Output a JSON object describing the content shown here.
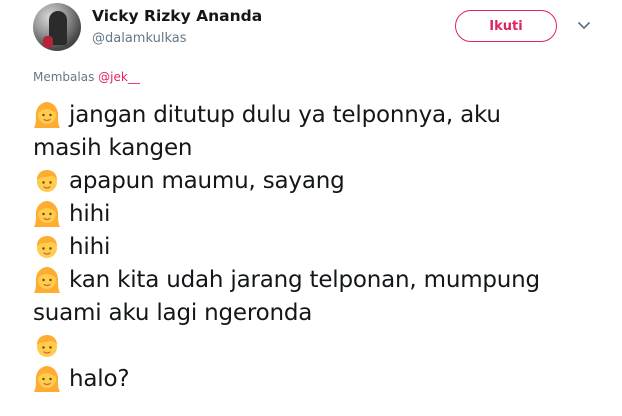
{
  "tweet": {
    "author": {
      "display_name": "Vicky Rizky Ananda",
      "handle": "@dalamkulkas"
    },
    "follow_button_label": "Ikuti",
    "reply_context": {
      "prefix": "Membalas ",
      "mention": "@jek__"
    },
    "lines": [
      {
        "emoji": "woman-emoji",
        "text": "jangan ditutup dulu ya telponnya, aku"
      },
      {
        "emoji": "",
        "text": "masih kangen"
      },
      {
        "emoji": "man-emoji",
        "text": "apapun maumu, sayang"
      },
      {
        "emoji": "woman-emoji",
        "text": "hihi"
      },
      {
        "emoji": "man-emoji",
        "text": "hihi"
      },
      {
        "emoji": "woman-emoji",
        "text": "kan kita udah jarang telponan, mumpung"
      },
      {
        "emoji": "",
        "text": "suami aku lagi ngeronda"
      },
      {
        "emoji": "man-emoji",
        "text": ""
      },
      {
        "emoji": "woman-emoji",
        "text": "halo?"
      }
    ]
  },
  "colors": {
    "accent": "#e0245e",
    "text": "#14171a",
    "secondary_text": "#657786",
    "emoji_yellow": "#ffcc4d",
    "emoji_hair": "#ffac33"
  }
}
